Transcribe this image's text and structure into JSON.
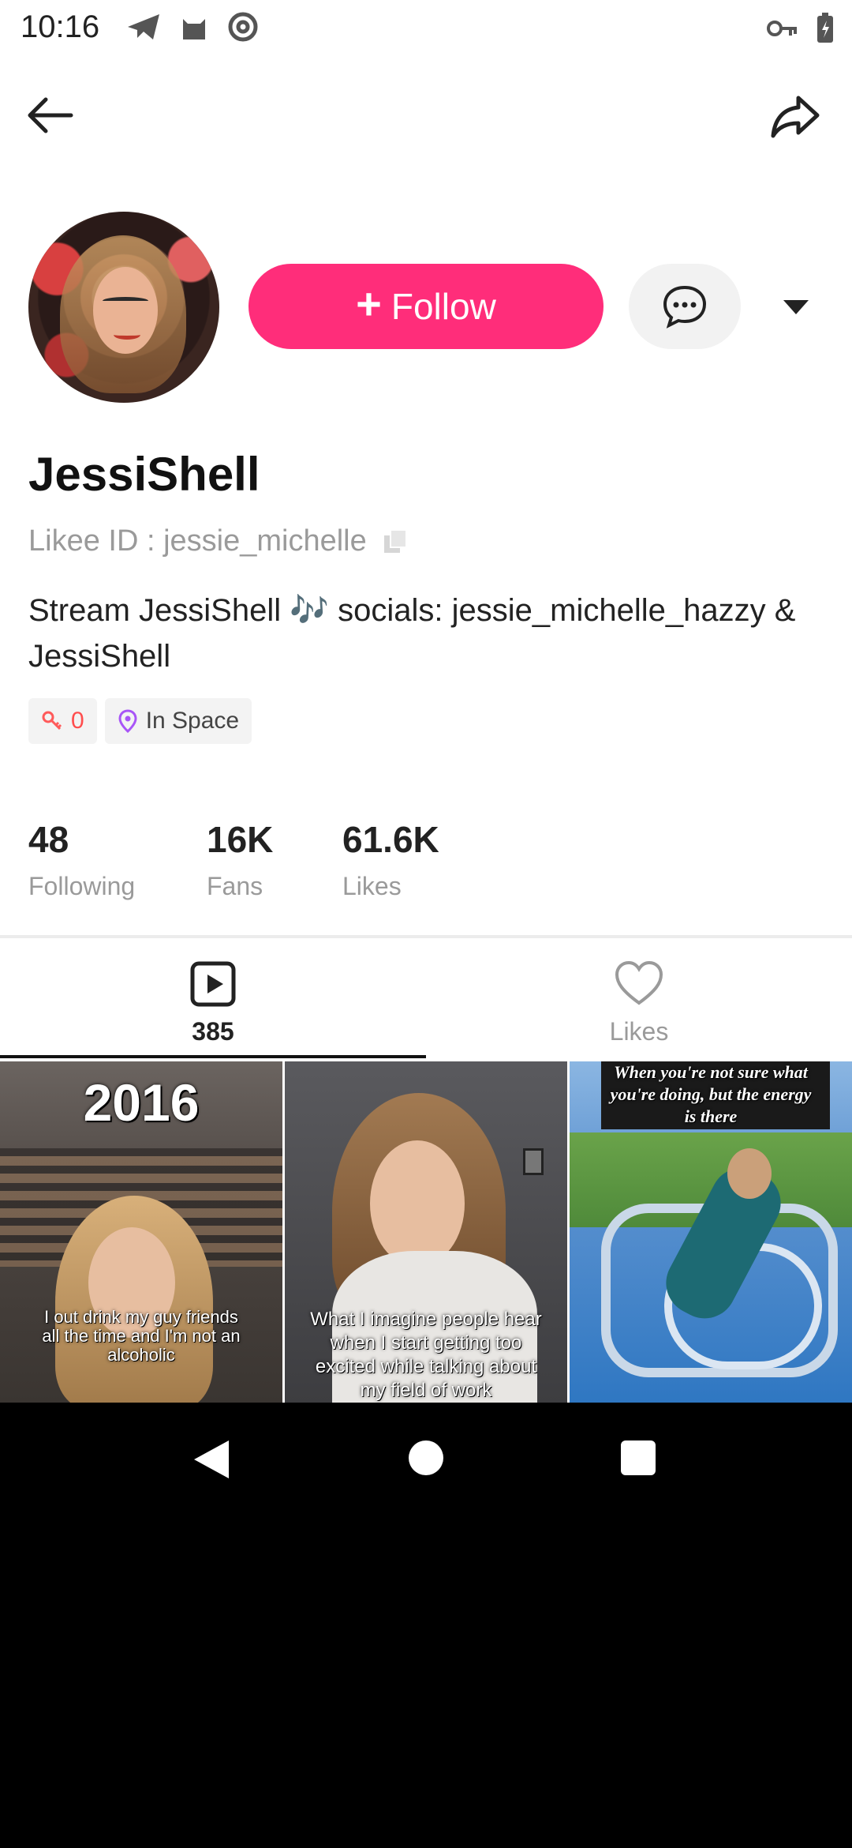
{
  "status_bar": {
    "time": "10:16",
    "left_icons": [
      "telegram-send-icon",
      "cat-icon",
      "at-sign-icon"
    ],
    "right_icons": [
      "key-icon",
      "battery-charging-icon"
    ]
  },
  "top_bar": {
    "back_icon": "arrow-left-icon",
    "share_icon": "share-arrow-icon"
  },
  "profile": {
    "follow_plus": "+",
    "follow_label": "Follow",
    "message_icon": "chat-bubble-icon",
    "dropdown_icon": "caret-down-icon",
    "username": "JessiShell",
    "likee_id": "Likee ID : jessie_michelle",
    "bio": "Stream JessiShell 🎶 socials: jessie_michelle_hazzy & JessiShell",
    "tags": [
      {
        "icon": "key-tag-icon",
        "value": "0"
      },
      {
        "icon": "location-pin-icon",
        "value": "In Space"
      }
    ]
  },
  "stats": [
    {
      "value": "48",
      "label": "Following"
    },
    {
      "value": "16K",
      "label": "Fans"
    },
    {
      "value": "61.6K",
      "label": "Likes"
    }
  ],
  "tabs": [
    {
      "icon": "play-video-icon",
      "label": "385",
      "active": true
    },
    {
      "icon": "heart-outline-icon",
      "label": "Likes",
      "active": false
    }
  ],
  "videos": [
    {
      "overlay_title": "2016",
      "caption": "I out drink my guy friends all the time and I'm not an alcoholic"
    },
    {
      "caption": "What I imagine people hear when I start getting too excited while talking about my field of work"
    },
    {
      "caption": "When you're not sure what you're doing, but the energy is there"
    }
  ],
  "colors": {
    "accent": "#ff2d7a",
    "secondary_text": "#9a9a9a",
    "location_pin": "#a855f7"
  }
}
